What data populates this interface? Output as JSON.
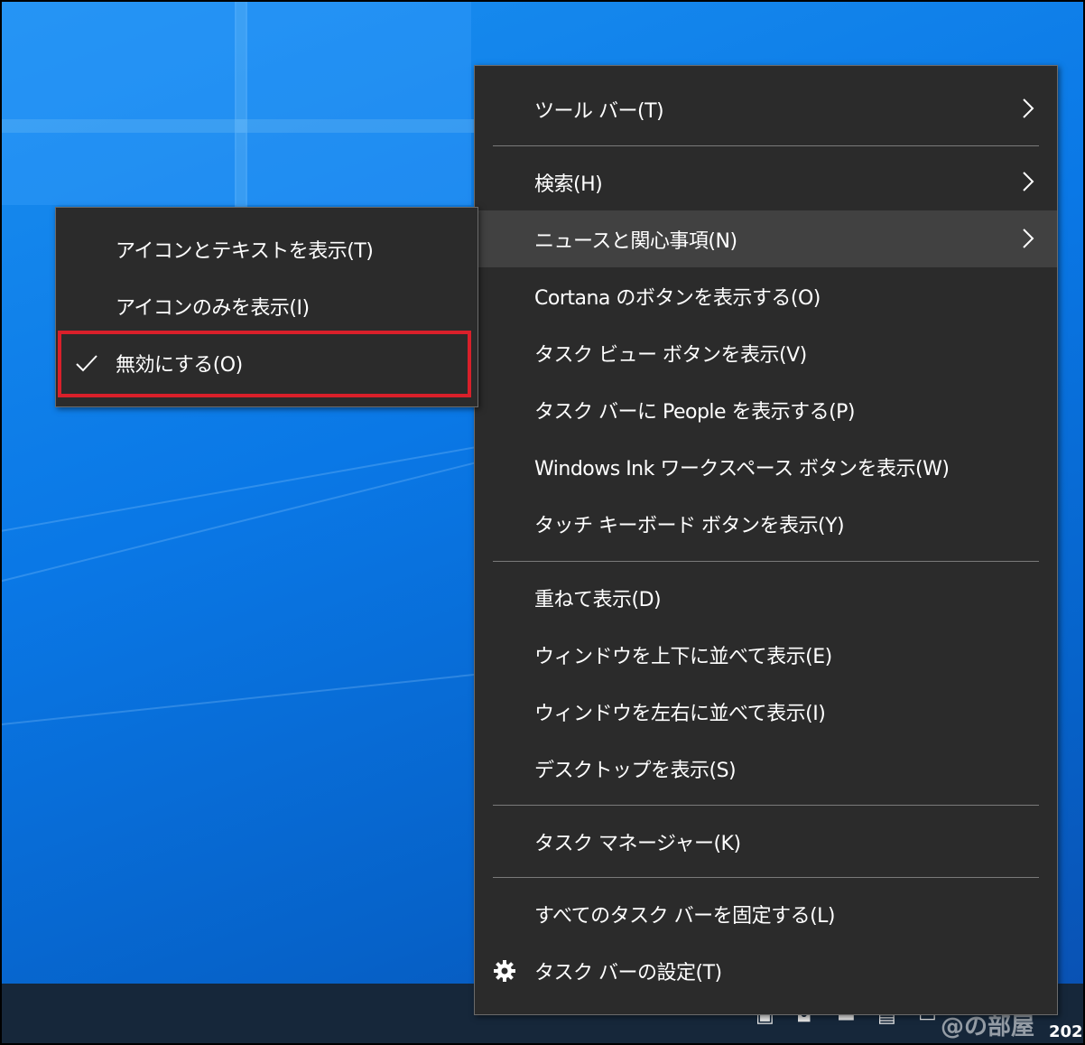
{
  "context_menu": {
    "items": [
      {
        "label": "ツール バー(T)",
        "submenu": true
      },
      {
        "label": "検索(H)",
        "submenu": true
      },
      {
        "label": "ニュースと関心事項(N)",
        "submenu": true,
        "hover": true
      },
      {
        "label": "Cortana のボタンを表示する(O)"
      },
      {
        "label": "タスク ビュー ボタンを表示(V)"
      },
      {
        "label": "タスク バーに People を表示する(P)"
      },
      {
        "label": "Windows Ink ワークスペース ボタンを表示(W)"
      },
      {
        "label": "タッチ キーボード ボタンを表示(Y)"
      },
      {
        "label": "重ねて表示(D)"
      },
      {
        "label": "ウィンドウを上下に並べて表示(E)"
      },
      {
        "label": "ウィンドウを左右に並べて表示(I)"
      },
      {
        "label": "デスクトップを表示(S)"
      },
      {
        "label": "タスク マネージャー(K)"
      },
      {
        "label": "すべてのタスク バーを固定する(L)"
      },
      {
        "label": "タスク バーの設定(T)",
        "icon": "gear-icon"
      }
    ]
  },
  "submenu": {
    "items": [
      {
        "label": "アイコンとテキストを表示(T)"
      },
      {
        "label": "アイコンのみを表示(I)"
      },
      {
        "label": "無効にする(O)",
        "checked": true,
        "icon": "checkmark-icon"
      }
    ],
    "highlight_color": "#d9202a"
  },
  "taskbar": {
    "clock_partial": "202",
    "watermark": "@の部屋"
  },
  "colors": {
    "menu_bg": "#2b2b2b",
    "hover_bg": "#414141",
    "desktop_blue": "#0a78e6"
  }
}
